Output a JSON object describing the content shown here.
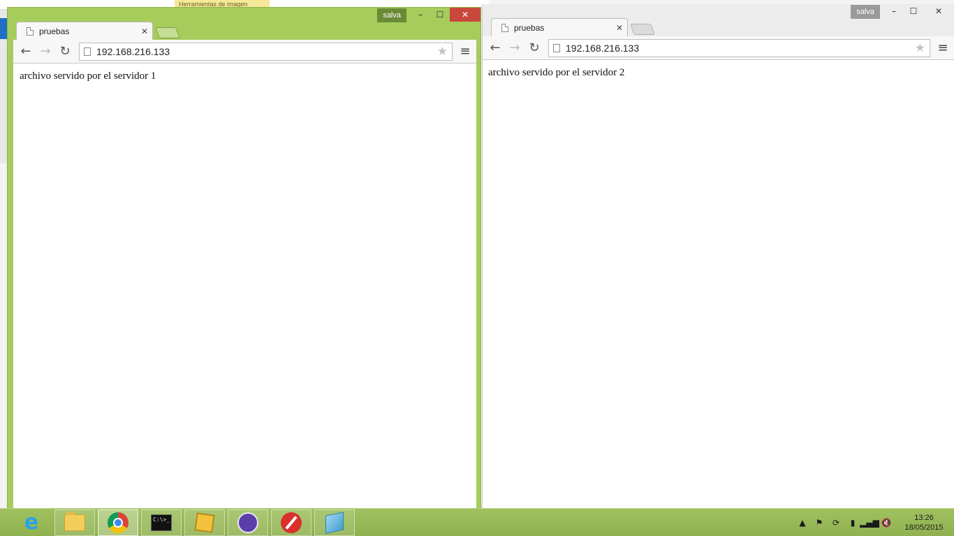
{
  "background": {
    "ribbon_tools_label": "Herramientas de imagen"
  },
  "left_window": {
    "user_name": "salva",
    "minimize_glyph": "–",
    "maximize_glyph": "☐",
    "close_glyph": "✕",
    "tab": {
      "title": "pruebas",
      "close": "✕"
    },
    "toolbar": {
      "back": "←",
      "forward": "→",
      "reload": "↻",
      "url": "192.168.216.133",
      "bookmark_star": "★",
      "menu": "≡"
    },
    "content_text": "archivo servido por el servidor 1",
    "frame_color": "#a6cc5c"
  },
  "right_window": {
    "user_name": "salva",
    "minimize_glyph": "–",
    "maximize_glyph": "☐",
    "close_glyph": "✕",
    "tab": {
      "title": "pruebas",
      "close": "✕"
    },
    "toolbar": {
      "back": "←",
      "forward": "→",
      "reload": "↻",
      "url": "192.168.216.133",
      "bookmark_star": "★",
      "menu": "≡"
    },
    "content_text": "archivo servido por el servidor 2",
    "frame_color": "#ececec"
  },
  "taskbar": {
    "apps": [
      {
        "icon": "internet-explorer-icon",
        "ie_glyph": "e"
      },
      {
        "icon": "file-explorer-icon"
      },
      {
        "icon": "chrome-icon"
      },
      {
        "icon": "command-prompt-icon",
        "cmd_text": "C:\\>_"
      },
      {
        "icon": "puzzle-app-icon"
      },
      {
        "icon": "cat-app-icon"
      },
      {
        "icon": "compass-app-icon"
      },
      {
        "icon": "notes-app-icon"
      }
    ],
    "tray": {
      "show_hidden": "▲",
      "flag": "⚑",
      "sync": "⟳",
      "battery": "▮",
      "signal": "▂▄▆",
      "volume": "🔇"
    },
    "clock": {
      "time": "13:26",
      "date": "18/05/2015"
    },
    "color": "#9fc160"
  }
}
